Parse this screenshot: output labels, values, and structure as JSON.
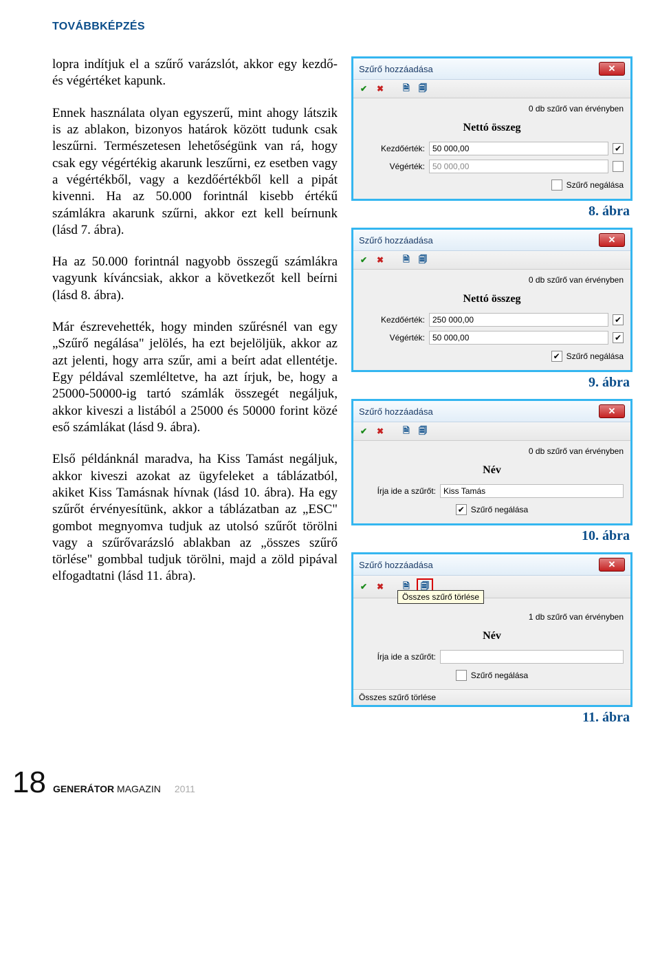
{
  "header": "TOVÁBBKÉPZÉS",
  "paragraphs": {
    "p1": "lopra indítjuk el a szűrő varázslót, akkor egy kezdő- és végértéket kapunk.",
    "p2": "Ennek használata olyan egyszerű, mint ahogy látszik is az ablakon, bizonyos határok között tudunk csak leszűrni. Természetesen lehetőségünk van rá, hogy csak egy végértékig akarunk leszűrni, ez esetben vagy a végértékből, vagy a kezdőértékből kell a pipát kivenni. Ha az 50.000 forintnál kisebb értékű számlákra akarunk szűrni, akkor ezt kell beírnunk (lásd 7. ábra).",
    "p3": "Ha az  50.000 forintnál nagyobb összegű számlákra vagyunk kíváncsiak, akkor a következőt kell beírni (lásd  8. ábra).",
    "p4": "Már észrevehették, hogy minden szűrésnél van egy „Szűrő negálása\" jelölés, ha ezt bejelöljük, akkor az azt jelenti, hogy arra szűr,  ami a beírt adat ellentétje. Egy példával szemléltetve, ha azt írjuk, be, hogy a 25000-50000-ig tartó számlák összegét negáljuk, akkor kiveszi a listából a 25000 és 50000 forint közé eső számlákat (lásd 9. ábra).",
    "p5": "Első példánknál maradva, ha Kiss Tamást negáljuk, akkor kiveszi azokat az ügyfeleket a táblázatból, akiket Kiss Tamásnak hívnak (lásd 10. ábra). Ha egy szűrőt érvényesítünk, akkor a táblázatban az „ESC\" gombot megnyomva tudjuk az utolsó szűrőt törölni vagy a szűrővarázsló ablakban az „összes szűrő törlése\" gombbal tudjuk törölni, majd a zöld pipával elfogadtatni (lásd 11. ábra)."
  },
  "captions": {
    "c8": "8. ábra",
    "c9": "9. ábra",
    "c10": "10. ábra",
    "c11": "11. ábra"
  },
  "windows": {
    "title": "Szűrő hozzáadása",
    "status0": "0 db szűrő van érvényben",
    "status1": "1 db szűrő van érvényben",
    "grp_netto": "Nettó összeg",
    "grp_nev": "Név",
    "lbl_kezdo": "Kezdőérték:",
    "lbl_veg": "Végérték:",
    "lbl_irja": "Írja ide a szűrőt:",
    "lbl_neg": "Szűrő negálása",
    "w8_k": "50 000,00",
    "w8_v": "50 000,00",
    "w9_k": "250 000,00",
    "w9_v": "50 000,00",
    "w10_val": "Kiss Tamás",
    "w11_val": "",
    "tooltip11": "Összes szűrő törlése",
    "footer11": "Összes szűrő törlése"
  },
  "footer": {
    "page": "18",
    "mag_b": "GENERÁTOR",
    "mag_r": " MAGAZIN",
    "year": "2011"
  }
}
